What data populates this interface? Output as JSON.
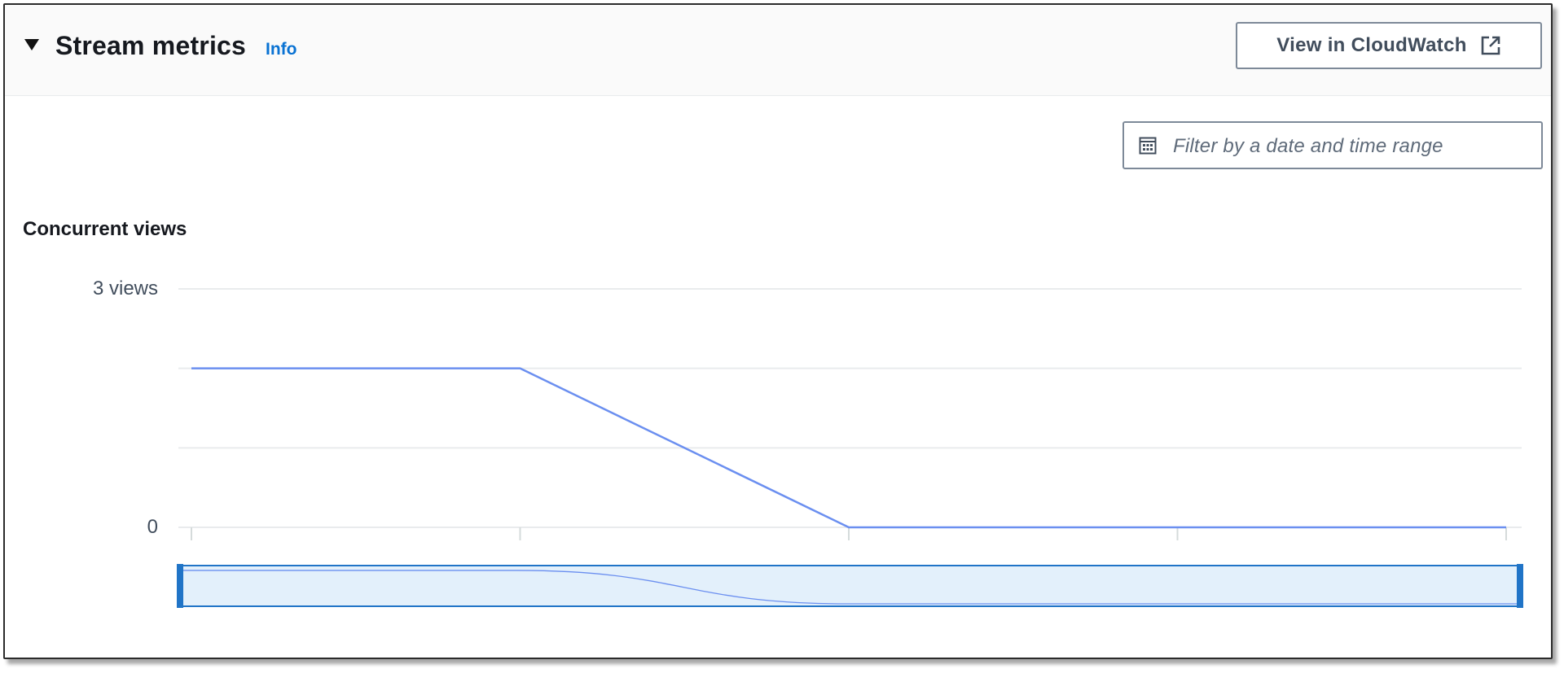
{
  "panel": {
    "title": "Stream metrics",
    "info_link": "Info",
    "cloudwatch_button": "View in CloudWatch",
    "date_filter_placeholder": "Filter by a date and time range",
    "icons": {
      "toggle": "caret-down-icon",
      "external": "external-link-icon",
      "calendar": "calendar-icon"
    }
  },
  "colors": {
    "series_line": "#6b8ff0",
    "navigator_fill": "#e3f0fb",
    "navigator_border": "#2074c7",
    "link": "#0972d3"
  },
  "chart_data": {
    "type": "line",
    "title": "Concurrent views",
    "ylim": [
      0,
      3
    ],
    "y_tick_labels": [
      {
        "value": 3,
        "label": "3 views"
      },
      {
        "value": 0,
        "label": "0"
      }
    ],
    "gridline_values": [
      3,
      2,
      1,
      0
    ],
    "x": [
      0,
      1,
      2,
      3,
      4
    ],
    "series": [
      {
        "values": [
          2,
          2,
          0,
          0,
          0
        ]
      }
    ],
    "navigator": true
  }
}
